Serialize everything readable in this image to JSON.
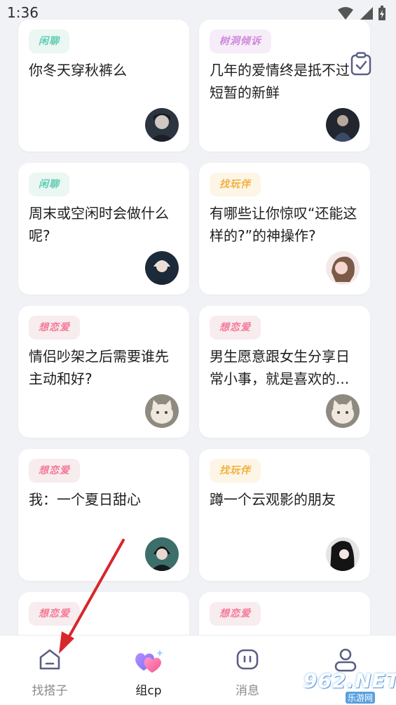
{
  "status": {
    "time": "1:36"
  },
  "cards": [
    {
      "tag": "闲聊",
      "title": "你冬天穿秋裤么"
    },
    {
      "tag": "树洞倾诉",
      "title": "几年的爱情终是抵不过短暂的新鲜"
    },
    {
      "tag": "闲聊",
      "title": "周末或空闲时会做什么呢?"
    },
    {
      "tag": "找玩伴",
      "title": "有哪些让你惊叹“还能这样的?”的神操作?"
    },
    {
      "tag": "想恋爱",
      "title": "情侣吵架之后需要谁先主动和好?"
    },
    {
      "tag": "想恋爱",
      "title": "男生愿意跟女生分享日常小事，就是喜欢的..."
    },
    {
      "tag": "想恋爱",
      "title": "我：一个夏日甜心"
    },
    {
      "tag": "找玩伴",
      "title": "蹲一个云观影的朋友"
    },
    {
      "tag": "想恋爱",
      "title": ""
    },
    {
      "tag": "想恋爱",
      "title": ""
    }
  ],
  "tabs": [
    {
      "label": "找搭子"
    },
    {
      "label": "组cp"
    },
    {
      "label": "消息"
    },
    {
      "label": ""
    }
  ],
  "watermark": {
    "brand": "962.NET",
    "sub": "乐游网"
  },
  "colors": {
    "background": "#f1f2f6",
    "tag_green": "#5fcdb2",
    "tag_pink": "#f57997",
    "tag_orange": "#f2b13f",
    "tag_purple": "#cf86dc",
    "arrow": "#d9262b"
  }
}
